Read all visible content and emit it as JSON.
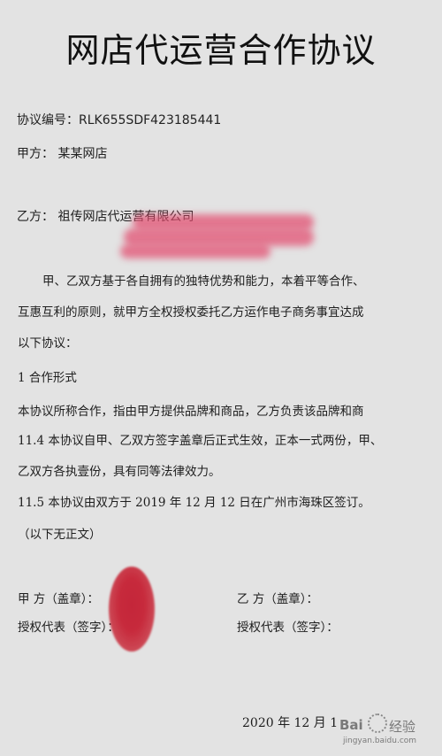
{
  "document": {
    "title": "网店代运营合作协议",
    "agreement_no": "协议编号：RLK655SDF423185441",
    "party_a": "甲方：  某某网店",
    "party_b": "乙方：  祖传网店代运营有限公司",
    "paragraphs": [
      "甲、乙双方基于各自拥有的独特优势和能力，本着平等合作、",
      "互惠互利的原则，就甲方全权授权委托乙方运作电子商务事宜达成",
      "以下协议：",
      "1   合作形式",
      "本协议所称合作，指由甲方提供品牌和商品，乙方负责该品牌和商",
      "11.4 本协议自甲、乙双方签字盖章后正式生效，正本一式两份，甲、",
      "乙双方各执壹份，具有同等法律效力。",
      "11.5 本协议由双方于 2019 年  12 月 12 日在广州市海珠区签订。",
      "（以下无正文）"
    ],
    "sign_a_seal": "甲     方（盖章）：",
    "sign_a_rep": "授权代表（签字）：",
    "sign_b_seal": "乙     方（盖章）：",
    "sign_b_rep": "授权代表（签字）：",
    "date": "2020 年  12 月  1"
  },
  "watermark": {
    "brand": "Bai",
    "service": "经验",
    "url": "jingyan.baidu.com",
    "icon": "baidu-paw-icon"
  },
  "colors": {
    "page": "#e3e3e3",
    "redaction": "#e2486c",
    "stamp": "#c4263a"
  }
}
